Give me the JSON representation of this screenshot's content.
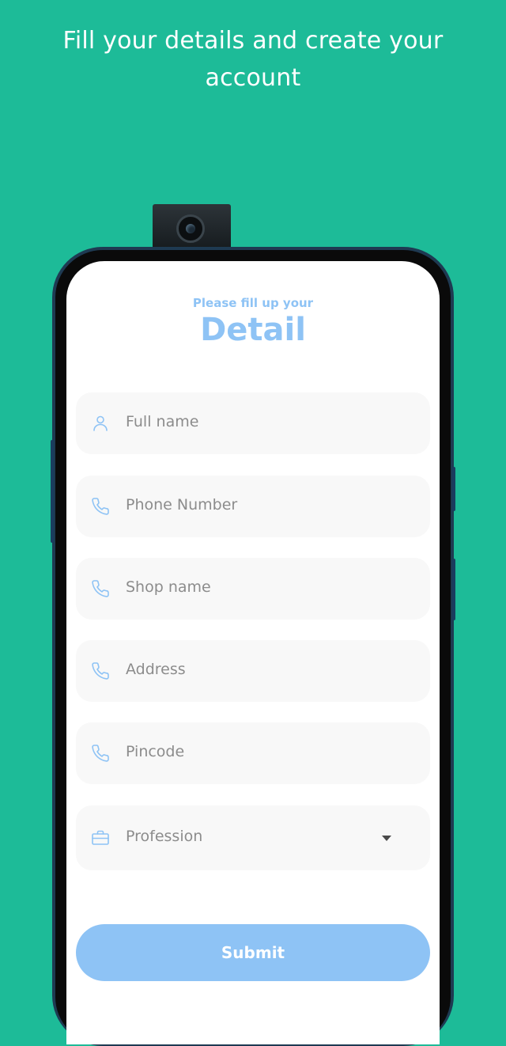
{
  "header": {
    "headline": "Fill your details and create your account"
  },
  "form": {
    "pre_title": "Please fill up your",
    "title": "Detail",
    "fields": [
      {
        "label": "Full name",
        "icon": "person-icon"
      },
      {
        "label": "Phone Number",
        "icon": "phone-icon"
      },
      {
        "label": "Shop name",
        "icon": "phone-icon"
      },
      {
        "label": "Address",
        "icon": "phone-icon"
      },
      {
        "label": "Pincode",
        "icon": "phone-icon"
      }
    ],
    "profession": {
      "label": "Profession",
      "icon": "briefcase-icon"
    },
    "submit_label": "Submit"
  },
  "colors": {
    "background": "#1dbb98",
    "accent": "#8ec3f5",
    "field_background": "#f8f8f8",
    "placeholder_text": "#8c8c8c"
  }
}
